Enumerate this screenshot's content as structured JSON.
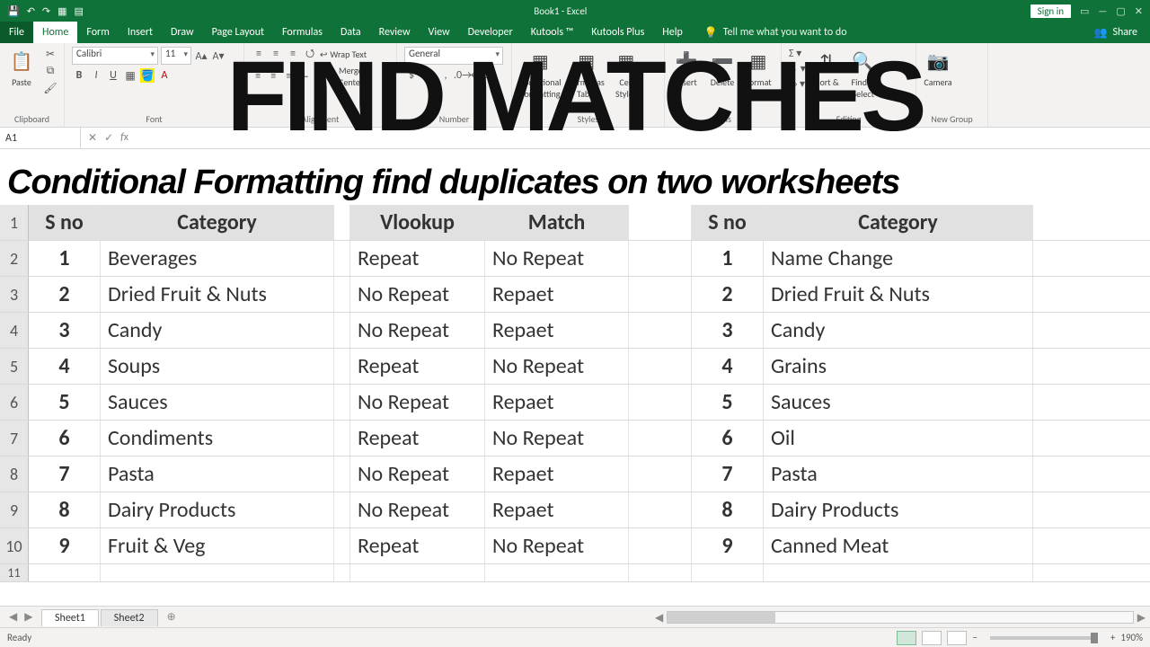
{
  "title": "Book1 - Excel",
  "signin": "Sign in",
  "tabs": [
    "File",
    "Home",
    "Form",
    "Insert",
    "Draw",
    "Page Layout",
    "Formulas",
    "Data",
    "Review",
    "View",
    "Developer",
    "Kutools ™",
    "Kutools Plus",
    "Help"
  ],
  "tell_me": "Tell me what you want to do",
  "share": "Share",
  "ribbon": {
    "clipboard": {
      "paste": "Paste",
      "label": "Clipboard"
    },
    "font": {
      "name": "Calibri",
      "size": "11",
      "label": "Font"
    },
    "alignment": {
      "wrap": "Wrap Text",
      "merge": "Merge & Center",
      "label": "Alignment"
    },
    "number": {
      "format": "General",
      "label": "Number"
    },
    "styles": {
      "cond": "Conditional\nFormatting",
      "fat": "Format as\nTable",
      "cs": "Cell\nStyles",
      "label": "Styles"
    },
    "cells": {
      "ins": "Insert",
      "del": "Delete",
      "fmt": "Format",
      "label": "Cells"
    },
    "editing": {
      "sort": "Sort &\nFilter",
      "find": "Find &\nSelect",
      "label": "Editing"
    },
    "newgroup": {
      "cam": "Camera",
      "label": "New Group"
    }
  },
  "namebox": "A1",
  "overlay": {
    "big": "FIND MATCHES",
    "sub": "Conditional Formatting find duplicates on two worksheets"
  },
  "headers": {
    "sno": "S no",
    "cat": "Category",
    "vl": "Vlookup",
    "mt": "Match",
    "sno2": "S no",
    "cat2": "Category"
  },
  "rows": [
    {
      "n": "1",
      "sno": "1",
      "cat": "Beverages",
      "vl": "Repeat",
      "mt": "No Repeat",
      "sno2": "1",
      "cat2": "Name Change"
    },
    {
      "n": "2",
      "sno": "2",
      "cat": "Dried Fruit & Nuts",
      "vl": "No Repeat",
      "mt": "Repaet",
      "sno2": "2",
      "cat2": "Dried Fruit & Nuts"
    },
    {
      "n": "3",
      "sno": "3",
      "cat": "Candy",
      "vl": "No Repeat",
      "mt": "Repaet",
      "sno2": "3",
      "cat2": "Candy"
    },
    {
      "n": "4",
      "sno": "4",
      "cat": "Soups",
      "vl": "Repeat",
      "mt": "No Repeat",
      "sno2": "4",
      "cat2": "Grains"
    },
    {
      "n": "5",
      "sno": "5",
      "cat": "Sauces",
      "vl": "No Repeat",
      "mt": "Repaet",
      "sno2": "5",
      "cat2": "Sauces"
    },
    {
      "n": "6",
      "sno": "6",
      "cat": "Condiments",
      "vl": "Repeat",
      "mt": "No Repeat",
      "sno2": "6",
      "cat2": "Oil"
    },
    {
      "n": "7",
      "sno": "7",
      "cat": "Pasta",
      "vl": "No Repeat",
      "mt": "Repaet",
      "sno2": "7",
      "cat2": "Pasta"
    },
    {
      "n": "8",
      "sno": "8",
      "cat": "Dairy Products",
      "vl": "No Repeat",
      "mt": "Repaet",
      "sno2": "8",
      "cat2": "Dairy Products"
    },
    {
      "n": "9",
      "sno": "9",
      "cat": "Fruit & Veg",
      "vl": "Repeat",
      "mt": "No Repeat",
      "sno2": "9",
      "cat2": "Canned Meat"
    }
  ],
  "row11": "11",
  "sheets": {
    "s1": "Sheet1",
    "s2": "Sheet2"
  },
  "status": {
    "ready": "Ready",
    "zoom": "190%"
  }
}
